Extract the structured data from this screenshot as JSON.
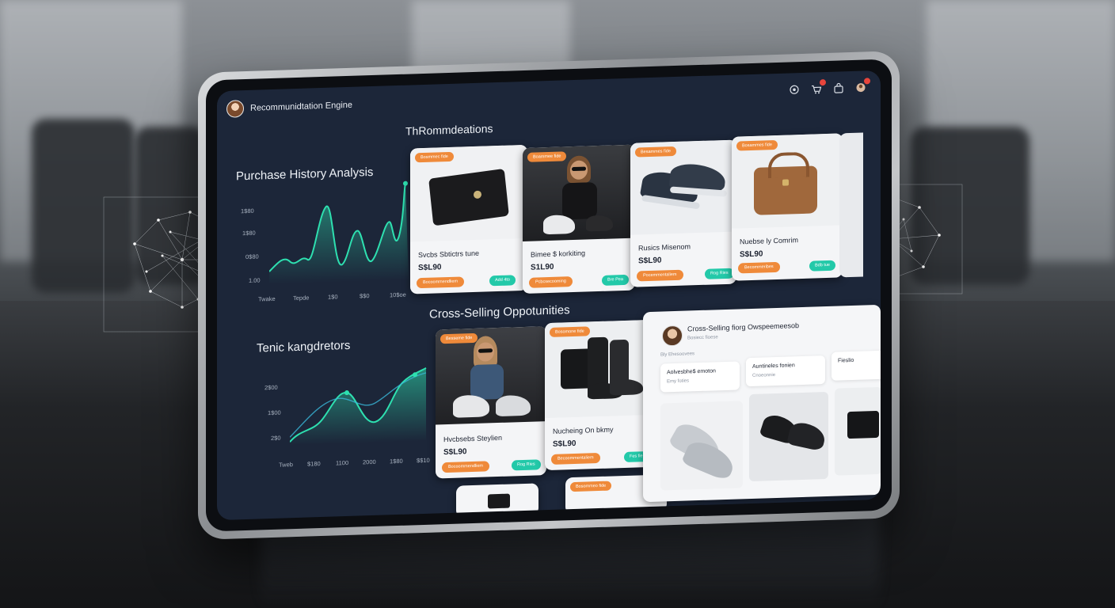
{
  "app": {
    "title": "Recommunidtation Engine"
  },
  "topbar": {
    "icons": [
      "settings-icon",
      "cart-icon",
      "bag-icon",
      "notification-icon"
    ],
    "accent_dot_color": "#e8453c"
  },
  "purchase_history": {
    "title": "Purchase History Analysis",
    "y_ticks": [
      "1$80",
      "1$80",
      "0$80",
      "1.00"
    ],
    "x_ticks": [
      "Twake",
      "Tepde",
      "1$0",
      "$$0",
      "10$oe"
    ],
    "line_color": "#2ee0b0"
  },
  "trending": {
    "title": "Tenic kangdretors",
    "y_ticks": [
      "2$00",
      "1$00",
      "2$0"
    ],
    "x_ticks": [
      "Tweb",
      "$180",
      "1100",
      "2000",
      "1$80",
      "$$10"
    ]
  },
  "recommendations": {
    "title": "ThRommdeations",
    "cards": [
      {
        "badge": "Bosmmec fide",
        "name": "Svcbs Sbtictrs tune",
        "price": "S$L90",
        "cta": "Bocoommendliem",
        "action": "Add 4to"
      },
      {
        "badge": "Boammee fide",
        "name": "Bimee $ korkiting",
        "price": "S1L90",
        "cta": "Pcbcsecooming",
        "action": "Bre Pea"
      },
      {
        "badge": "Besammes fide",
        "name": "Rusics Misenom",
        "price": "S$L90",
        "cta": "Pocemmentaliem",
        "action": "Rog Ries"
      },
      {
        "badge": "Bosammes fide",
        "name": "Nuebse ly Comrim",
        "price": "S$L90",
        "cta": "Becommeribes",
        "action": "Bdb tue"
      }
    ]
  },
  "cross_selling": {
    "title": "Cross-Selling Oppotunities",
    "cards": [
      {
        "badge": "Besseme fide",
        "name": "Hvcbsebs Steylien",
        "price": "S$L90",
        "cta": "Bocoommendliem",
        "action": "Rog Ries"
      },
      {
        "badge": "Bosomone fide",
        "name": "Nucheing On bkmy",
        "price": "S$L90",
        "cta": "Becoommentaliem",
        "action": "Fes fie"
      },
      {
        "badge": "",
        "name": "",
        "price": "",
        "cta": "",
        "action": ""
      },
      {
        "badge": "Bosommeo fide",
        "name": "",
        "price": "",
        "cta": "",
        "action": ""
      }
    ],
    "panel": {
      "title": "Cross-Selling fiorg Owspeemeesob",
      "subtitle": "Bosiecc fioese",
      "subtitle2": "Bly Ehesoovees",
      "items": [
        {
          "title": "Aolvesbhe$ emoton",
          "sub": "Emy foties"
        },
        {
          "title": "Auntineles fonien",
          "sub": "Cnoeonnie"
        },
        {
          "title": "Fieslio",
          "sub": ""
        }
      ]
    }
  }
}
